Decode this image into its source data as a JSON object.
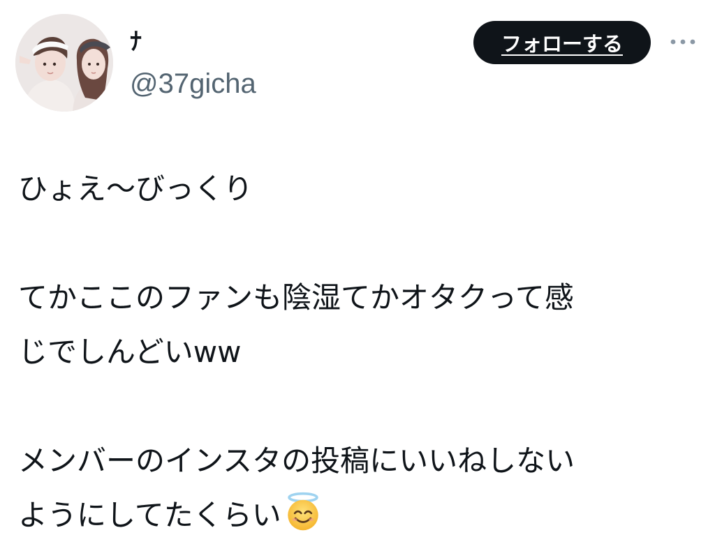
{
  "user": {
    "display_name": "ﾅ",
    "handle": "@37gicha"
  },
  "header": {
    "follow_label": "フォローする",
    "more_icon": "more-horizontal-icon"
  },
  "tweet": {
    "lines": [
      "ひょえ〜びっくり",
      "てかここのファンも陰湿てかオタクって感",
      "じでしんどいww",
      "メンバーのインスタの投稿にいいねしない",
      "ようにしてたくらい"
    ],
    "emoji": "smiling-face-with-halo-emoji"
  },
  "colors": {
    "text": "#0f1419",
    "secondary": "#536471",
    "button_bg": "#0f1419",
    "button_text": "#ffffff",
    "background": "#ffffff"
  }
}
